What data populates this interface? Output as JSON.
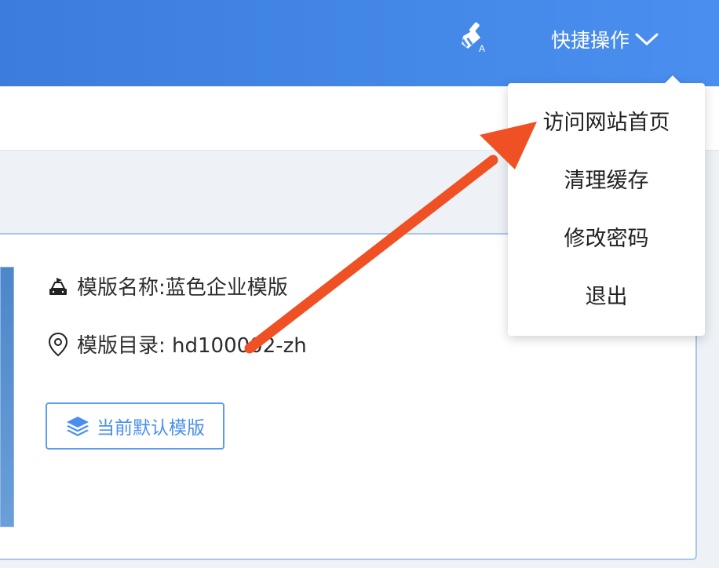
{
  "topbar": {
    "brush_icon": "clear-cache-brush-icon",
    "quick_actions_label": "快捷操作",
    "quick_actions_icon": "chevron-down-icon"
  },
  "dropdown": {
    "items": [
      {
        "label": "访问网站首页"
      },
      {
        "label": "清理缓存"
      },
      {
        "label": "修改密码"
      },
      {
        "label": "退出"
      }
    ]
  },
  "template_card": {
    "name_label": "模版名称:",
    "name_value": "蓝色企业模版",
    "name_icon": "template-icon",
    "dir_label": "模版目录:",
    "dir_value": "hd100002-zh",
    "dir_icon": "location-pin-icon",
    "default_button_label": "当前默认模版",
    "default_button_icon": "layers-icon"
  },
  "colors": {
    "topbar": "#4a8fef",
    "accent": "#4a8fef",
    "annotation_arrow": "#ef5124"
  }
}
